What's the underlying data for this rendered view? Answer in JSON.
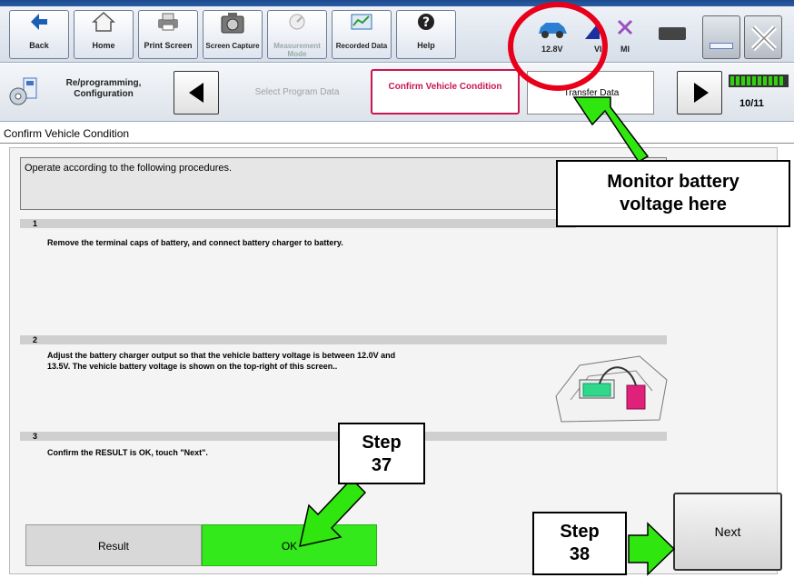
{
  "toolbar": {
    "back_label": "Back",
    "home_label": "Home",
    "print_label": "Print Screen",
    "capture_label": "Screen Capture",
    "measurement_label": "Measurement Mode",
    "recorded_label": "Recorded Data",
    "help_label": "Help"
  },
  "status": {
    "battery_voltage": "12.8V",
    "vi_label": "VI",
    "mi_label": "MI"
  },
  "nav": {
    "section_label": "Re/programming, Configuration",
    "step_prev": "Select Program Data",
    "step_current": "Confirm Vehicle Condition",
    "step_next": "Transfer Data",
    "page_indicator": "10/11"
  },
  "page": {
    "title": "Confirm Vehicle Condition",
    "instruction": "Operate according to the following procedures.",
    "steps": [
      {
        "num": "1",
        "text": "Remove the terminal caps of battery, and connect battery charger to battery."
      },
      {
        "num": "2",
        "text_line1": "Adjust the battery charger output so that the vehicle battery voltage is between 12.0V and",
        "text_line2": "13.5V. The vehicle battery voltage is shown on the top-right of this screen.."
      },
      {
        "num": "3",
        "text": "Confirm the RESULT is OK, touch \"Next\"."
      }
    ],
    "result_label": "Result",
    "result_value": "OK",
    "next_label": "Next"
  },
  "annotations": {
    "monitor_line1": "Monitor battery",
    "monitor_line2": "voltage here",
    "step37_line1": "Step",
    "step37_line2": "37",
    "step38_line1": "Step",
    "step38_line2": "38"
  },
  "colors": {
    "ok_green": "#33e81b",
    "arrow_green": "#2fe60f",
    "highlight_red": "#e8001b",
    "current_tab": "#c8174f"
  }
}
